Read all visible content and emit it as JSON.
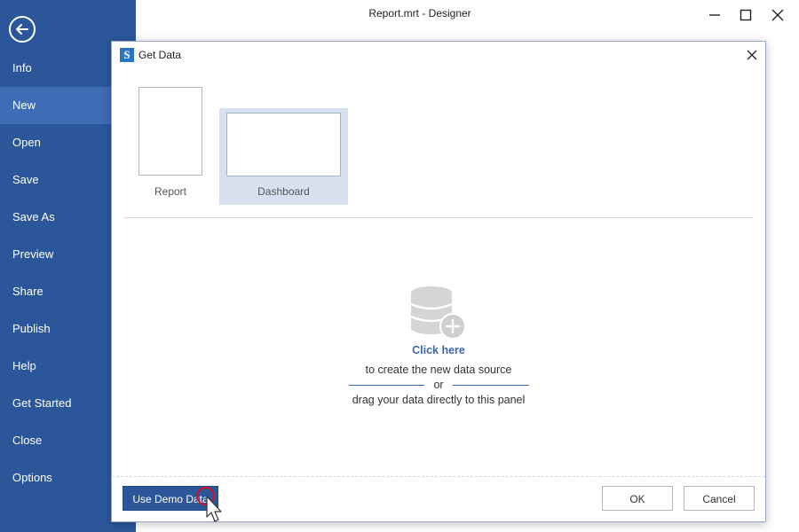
{
  "window": {
    "title": "Report.mrt - Designer",
    "controls": [
      "minimize-icon",
      "maximize-icon",
      "close-icon"
    ]
  },
  "sidebar": {
    "back_icon": "arrow-left-icon",
    "items": [
      {
        "label": "Info",
        "active": false
      },
      {
        "label": "New",
        "active": true
      },
      {
        "label": "Open",
        "active": false
      },
      {
        "label": "Save",
        "active": false
      },
      {
        "label": "Save As",
        "active": false
      },
      {
        "label": "Preview",
        "active": false
      },
      {
        "label": "Share",
        "active": false
      },
      {
        "label": "Publish",
        "active": false
      },
      {
        "label": "Help",
        "active": false
      },
      {
        "label": "Get Started",
        "active": false
      },
      {
        "label": "Close",
        "active": false
      },
      {
        "label": "Options",
        "active": false
      }
    ]
  },
  "dialog": {
    "title": "Get Data",
    "templates": [
      {
        "label": "Report",
        "selected": false
      },
      {
        "label": "Dashboard",
        "selected": true
      }
    ],
    "empty_state": {
      "icon": "database-add-icon",
      "link": "Click here",
      "line1": "to create the new data source",
      "or": "or",
      "line2": "drag your data directly to this panel"
    },
    "buttons": {
      "demo": "Use Demo Data",
      "ok": "OK",
      "cancel": "Cancel"
    }
  },
  "colors": {
    "sidebar": "#2b579a",
    "sidebar_active": "#3e6db5",
    "accent_link": "#3b68aa",
    "selected_template": "#d6e0ef",
    "cursor_ring": "#d4121e"
  }
}
